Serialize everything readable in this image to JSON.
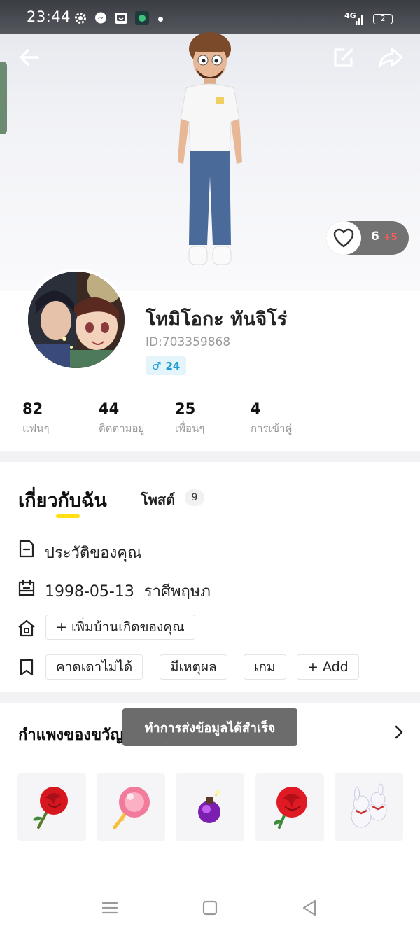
{
  "status_bar": {
    "time": "23:44",
    "network": "4G",
    "battery": "2",
    "icons": [
      "gear-icon",
      "messenger-icon",
      "app-face-icon",
      "shield-app-icon"
    ]
  },
  "header": {
    "back": "arrow-left-icon",
    "edit": "edit-icon",
    "share": "share-icon"
  },
  "likes": {
    "count": "6",
    "plus": "+5"
  },
  "profile": {
    "name": "โทมิโอกะ ทันจิโร่",
    "id": "ID:703359868",
    "gender_symbol": "♂",
    "age": "24"
  },
  "stats": [
    {
      "value": "82",
      "label": "แฟนๆ"
    },
    {
      "value": "44",
      "label": "ติดตามอยู่"
    },
    {
      "value": "25",
      "label": "เพื่อนๆ"
    },
    {
      "value": "4",
      "label": "การเข้าคู่"
    }
  ],
  "tabs": {
    "about": "เกี่ยวกับฉัน",
    "posts": "โพสต์",
    "posts_count": "9"
  },
  "about": {
    "bio": "ประวัติของคุณ",
    "birthday": "1998-05-13",
    "zodiac": "ราศีพฤษภ",
    "add_hometown": "+ เพิ่มบ้านเกิดของคุณ",
    "tags": [
      "คาดเดาไม่ได้",
      "มีเหตุผล",
      "เกม"
    ],
    "add_tag": "+ Add"
  },
  "gift_wall": {
    "title": "กำแพงของขวัญ",
    "count": "5",
    "items": [
      "rose",
      "lollipop",
      "potion",
      "rose",
      "plush-bunnies"
    ]
  },
  "toast": "ทำการส่งข้อมูลได้สำเร็จ",
  "colors": {
    "accent_yellow": "#ffe014",
    "gender_blue": "#1d9bd4",
    "likes_bg": "#727272",
    "likes_plus": "#ff5c5c"
  }
}
